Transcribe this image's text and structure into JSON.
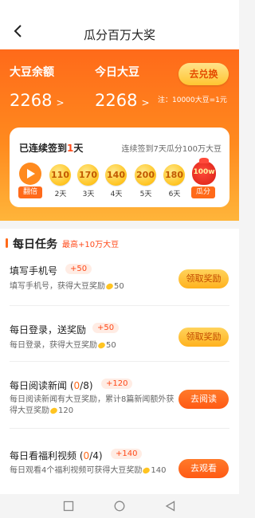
{
  "header": {
    "title": "瓜分百万大奖"
  },
  "balance": {
    "label": "大豆余额",
    "value": "2268",
    "arrow": ">"
  },
  "today": {
    "label": "今日大豆",
    "value": "2268",
    "arrow": ">"
  },
  "exchange_button": "去兑换",
  "rate_note": "注：10000大豆=1元",
  "checkin": {
    "title_prefix": "已连续签到",
    "title_count": "1",
    "title_suffix": "天",
    "tip": "连续签到7天瓜分100万大豆",
    "first_tag": "翻倍",
    "days": [
      {
        "value": "110",
        "label": "2天"
      },
      {
        "value": "170",
        "label": "3天"
      },
      {
        "value": "140",
        "label": "4天"
      },
      {
        "value": "200",
        "label": "5天"
      },
      {
        "value": "180",
        "label": "6天"
      }
    ],
    "bag_text": "100w",
    "last_tag": "瓜分"
  },
  "tasks": {
    "title": "每日任务",
    "subtitle": "最高+10万大豆",
    "items": [
      {
        "name": "填写手机号",
        "progress": "",
        "reward": "+50",
        "desc": "填写手机号，获得大豆奖励",
        "desc_value": "50",
        "button": "领取奖励"
      },
      {
        "name": "每日登录，送奖励",
        "progress": "",
        "reward": "+50",
        "desc": "每日登录，获得大豆奖励",
        "desc_value": "50",
        "button": "领取奖励"
      },
      {
        "name": "每日阅读新闻",
        "progress_pre": "(",
        "progress_cur": "0",
        "progress_post": "/8)",
        "reward": "+120",
        "desc": "每日阅读新闻有大豆奖励，累计8篇新闻额外获得大豆奖励",
        "desc_value": "120",
        "button": "去阅读"
      },
      {
        "name": "每日看福利视频",
        "progress_pre": "(",
        "progress_cur": "0",
        "progress_post": "/4)",
        "reward": "+140",
        "desc": "每日观看4个福利视频可获得大豆奖励",
        "desc_value": "140",
        "button": "去观看"
      }
    ]
  },
  "colors": {
    "accent": "#ff6a1a",
    "gold": "#ffc421",
    "red": "#ff4a1a"
  }
}
